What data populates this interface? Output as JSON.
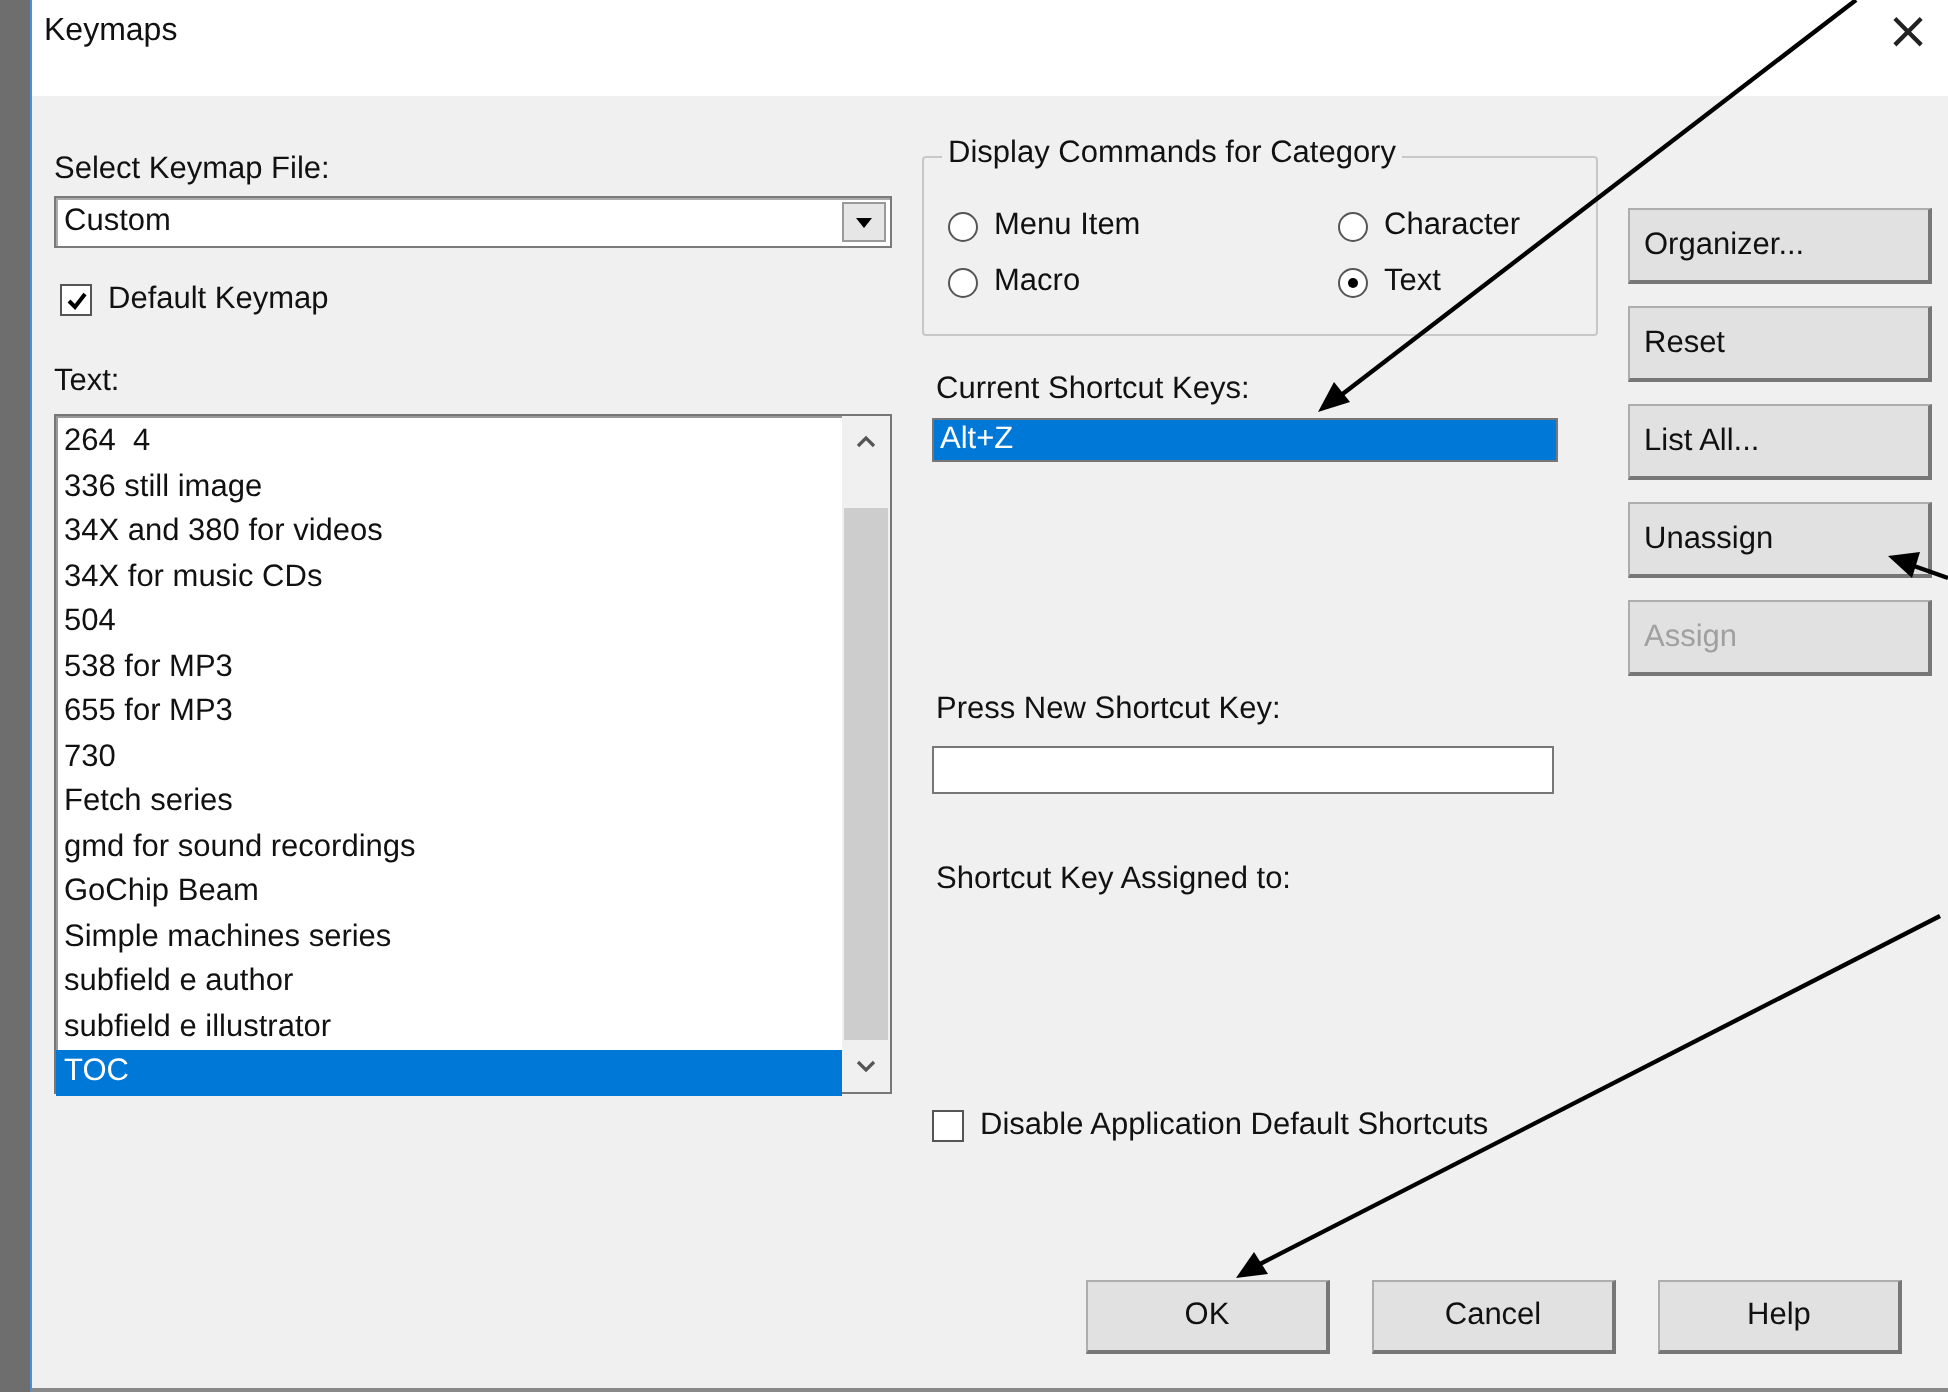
{
  "window": {
    "title": "Keymaps",
    "close": "×"
  },
  "keymap_file": {
    "label": "Select Keymap File:",
    "value": "Custom"
  },
  "default_keymap": {
    "label": "Default Keymap",
    "checked": true
  },
  "text_list": {
    "label": "Text:",
    "items": [
      {
        "label": "264  4",
        "selected": false
      },
      {
        "label": "336 still image",
        "selected": false
      },
      {
        "label": "34X and 380 for videos",
        "selected": false
      },
      {
        "label": "34X for music CDs",
        "selected": false
      },
      {
        "label": "504",
        "selected": false
      },
      {
        "label": "538 for MP3",
        "selected": false
      },
      {
        "label": "655 for MP3",
        "selected": false
      },
      {
        "label": "730",
        "selected": false
      },
      {
        "label": "Fetch series",
        "selected": false
      },
      {
        "label": "gmd for sound recordings",
        "selected": false
      },
      {
        "label": "GoChip Beam",
        "selected": false
      },
      {
        "label": "Simple machines series",
        "selected": false
      },
      {
        "label": "subfield e author",
        "selected": false
      },
      {
        "label": "subfield e illustrator",
        "selected": false
      },
      {
        "label": "TOC",
        "selected": true
      }
    ]
  },
  "category": {
    "title": "Display Commands for Category",
    "options": [
      {
        "label": "Menu Item",
        "selected": false
      },
      {
        "label": "Character",
        "selected": false
      },
      {
        "label": "Macro",
        "selected": false
      },
      {
        "label": "Text",
        "selected": true
      }
    ]
  },
  "current_keys": {
    "label": "Current Shortcut Keys:",
    "items": [
      {
        "label": "Alt+Z",
        "selected": true
      }
    ]
  },
  "new_key": {
    "label": "Press New Shortcut Key:"
  },
  "assigned_to": {
    "label": "Shortcut Key Assigned to:"
  },
  "disable_defaults": {
    "label": "Disable Application Default Shortcuts",
    "checked": false
  },
  "side_buttons": [
    {
      "label": "Organizer...",
      "disabled": false
    },
    {
      "label": "Reset",
      "disabled": false
    },
    {
      "label": "List All...",
      "disabled": false
    },
    {
      "label": "Unassign",
      "disabled": false
    },
    {
      "label": "Assign",
      "disabled": true
    }
  ],
  "bottom_buttons": [
    "OK",
    "Cancel",
    "Help"
  ]
}
